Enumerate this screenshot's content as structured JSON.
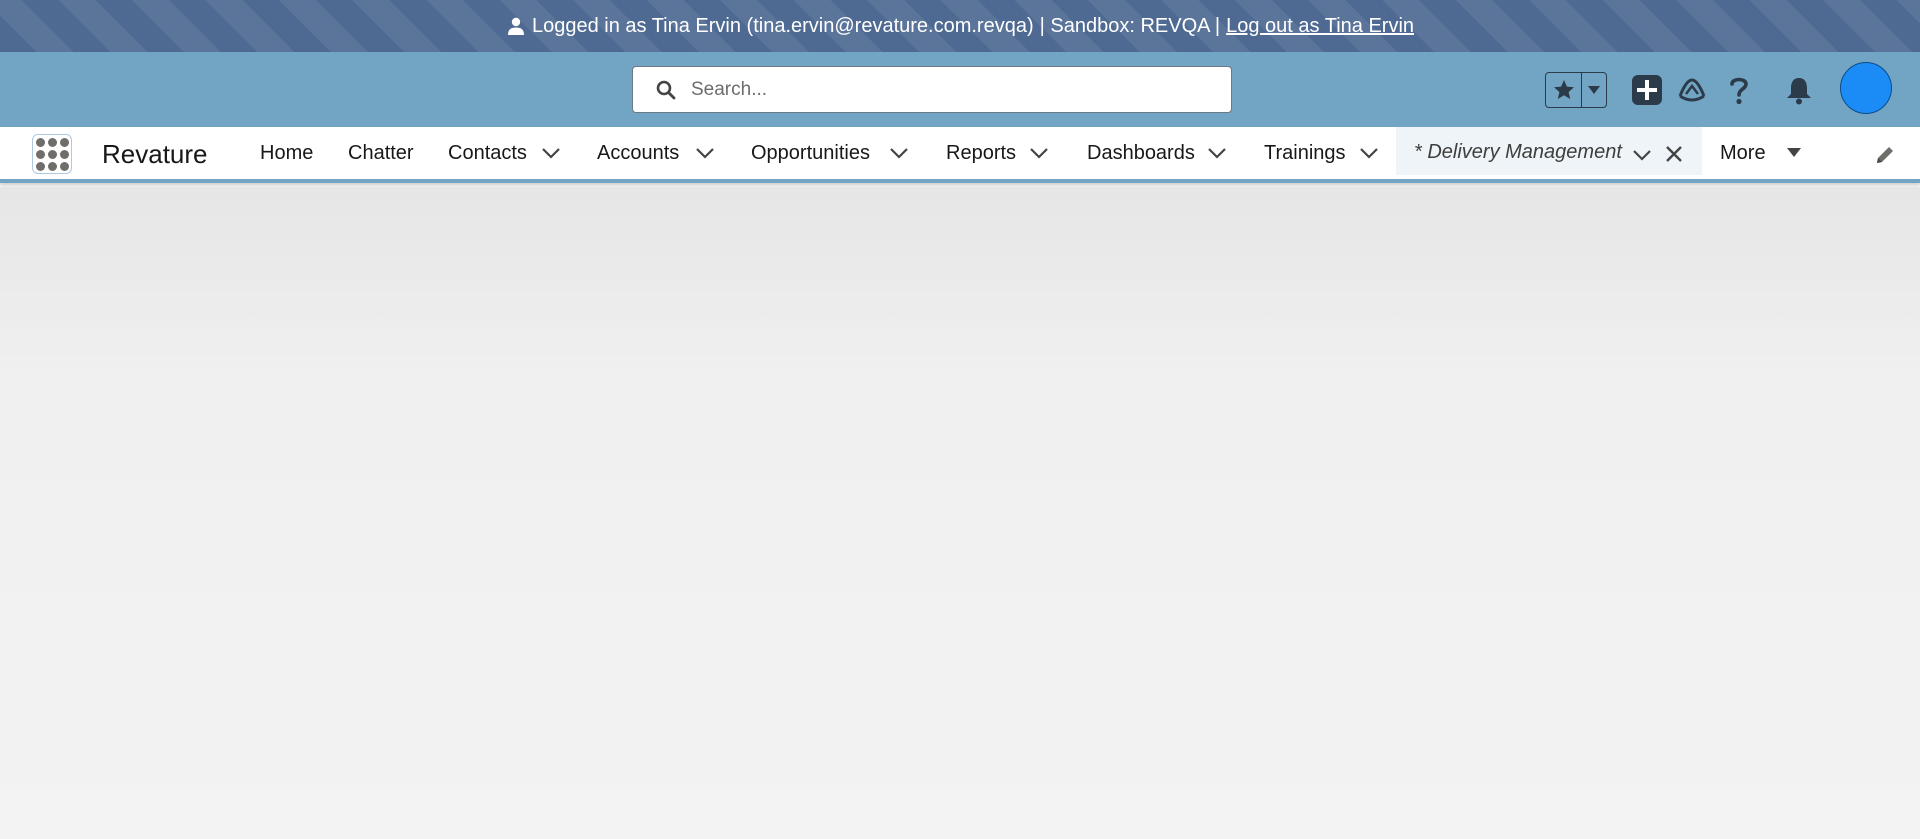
{
  "banner": {
    "logged_in_text": "Logged in as Tina Ervin (tina.ervin@revature.com.revqa)",
    "sandbox_text": "| Sandbox: REVQA |",
    "logout_link": "Log out as Tina Ervin",
    "icon": "user-icon"
  },
  "header": {
    "search_placeholder": "Search...",
    "icons": [
      "search-icon",
      "favorites-star-icon",
      "favorites-caret-icon",
      "global-actions-plus-icon",
      "trailhead-icon",
      "help-icon",
      "notifications-bell-icon"
    ],
    "avatar_color": "#1b8cf5",
    "background_color": "#72a4c4"
  },
  "nav": {
    "app_name": "Revature",
    "items": [
      {
        "label": "Home",
        "has_menu": false
      },
      {
        "label": "Chatter",
        "has_menu": false
      },
      {
        "label": "Contacts",
        "has_menu": true
      },
      {
        "label": "Accounts",
        "has_menu": true
      },
      {
        "label": "Opportunities",
        "has_menu": true
      },
      {
        "label": "Reports",
        "has_menu": true
      },
      {
        "label": "Dashboards",
        "has_menu": true
      },
      {
        "label": "Trainings",
        "has_menu": true
      }
    ],
    "active_tab": {
      "label": "* Delivery Management"
    },
    "more_label": "More"
  },
  "colors": {
    "banner": "#4f6a92",
    "accent": "#72a4c4",
    "background": "#f3f3f3"
  }
}
